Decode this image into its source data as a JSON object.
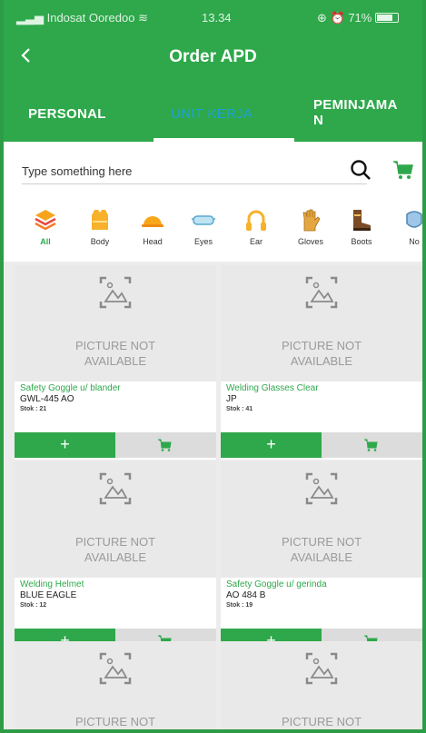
{
  "status": {
    "carrier": "Indosat Ooredoo",
    "time": "13.34",
    "battery": "71%"
  },
  "header": {
    "title": "Order APD"
  },
  "tabs": [
    {
      "label": "PERSONAL"
    },
    {
      "label": "UNIT KERJA"
    },
    {
      "label": "PEMINJAMA N"
    }
  ],
  "search": {
    "placeholder": "Type something here"
  },
  "categories": [
    {
      "label": "All",
      "icon": "layers-icon"
    },
    {
      "label": "Body",
      "icon": "vest-icon"
    },
    {
      "label": "Head",
      "icon": "helmet-icon"
    },
    {
      "label": "Eyes",
      "icon": "goggles-icon"
    },
    {
      "label": "Ear",
      "icon": "earmuff-icon"
    },
    {
      "label": "Gloves",
      "icon": "glove-icon"
    },
    {
      "label": "Boots",
      "icon": "boot-icon"
    },
    {
      "label": "No",
      "icon": "respirator-icon"
    }
  ],
  "placeholder_text": "PICTURE NOT AVAILABLE",
  "products": [
    {
      "name": "Safety Goggle u/ blander",
      "code": "GWL-445 AO",
      "stok": "Stok : 21",
      "add_label": "+"
    },
    {
      "name": "Welding Glasses Clear",
      "code": "JP",
      "stok": "Stok : 41",
      "add_label": "+"
    },
    {
      "name": "Welding Helmet",
      "code": "BLUE EAGLE",
      "stok": "Stok : 12",
      "add_label": "+"
    },
    {
      "name": "Safety Goggle u/ gerinda",
      "code": "AO 484 B",
      "stok": "Stok : 19",
      "add_label": "+"
    }
  ],
  "colors": {
    "primary": "#2ea84b",
    "tab_active": "#1fa0de"
  }
}
